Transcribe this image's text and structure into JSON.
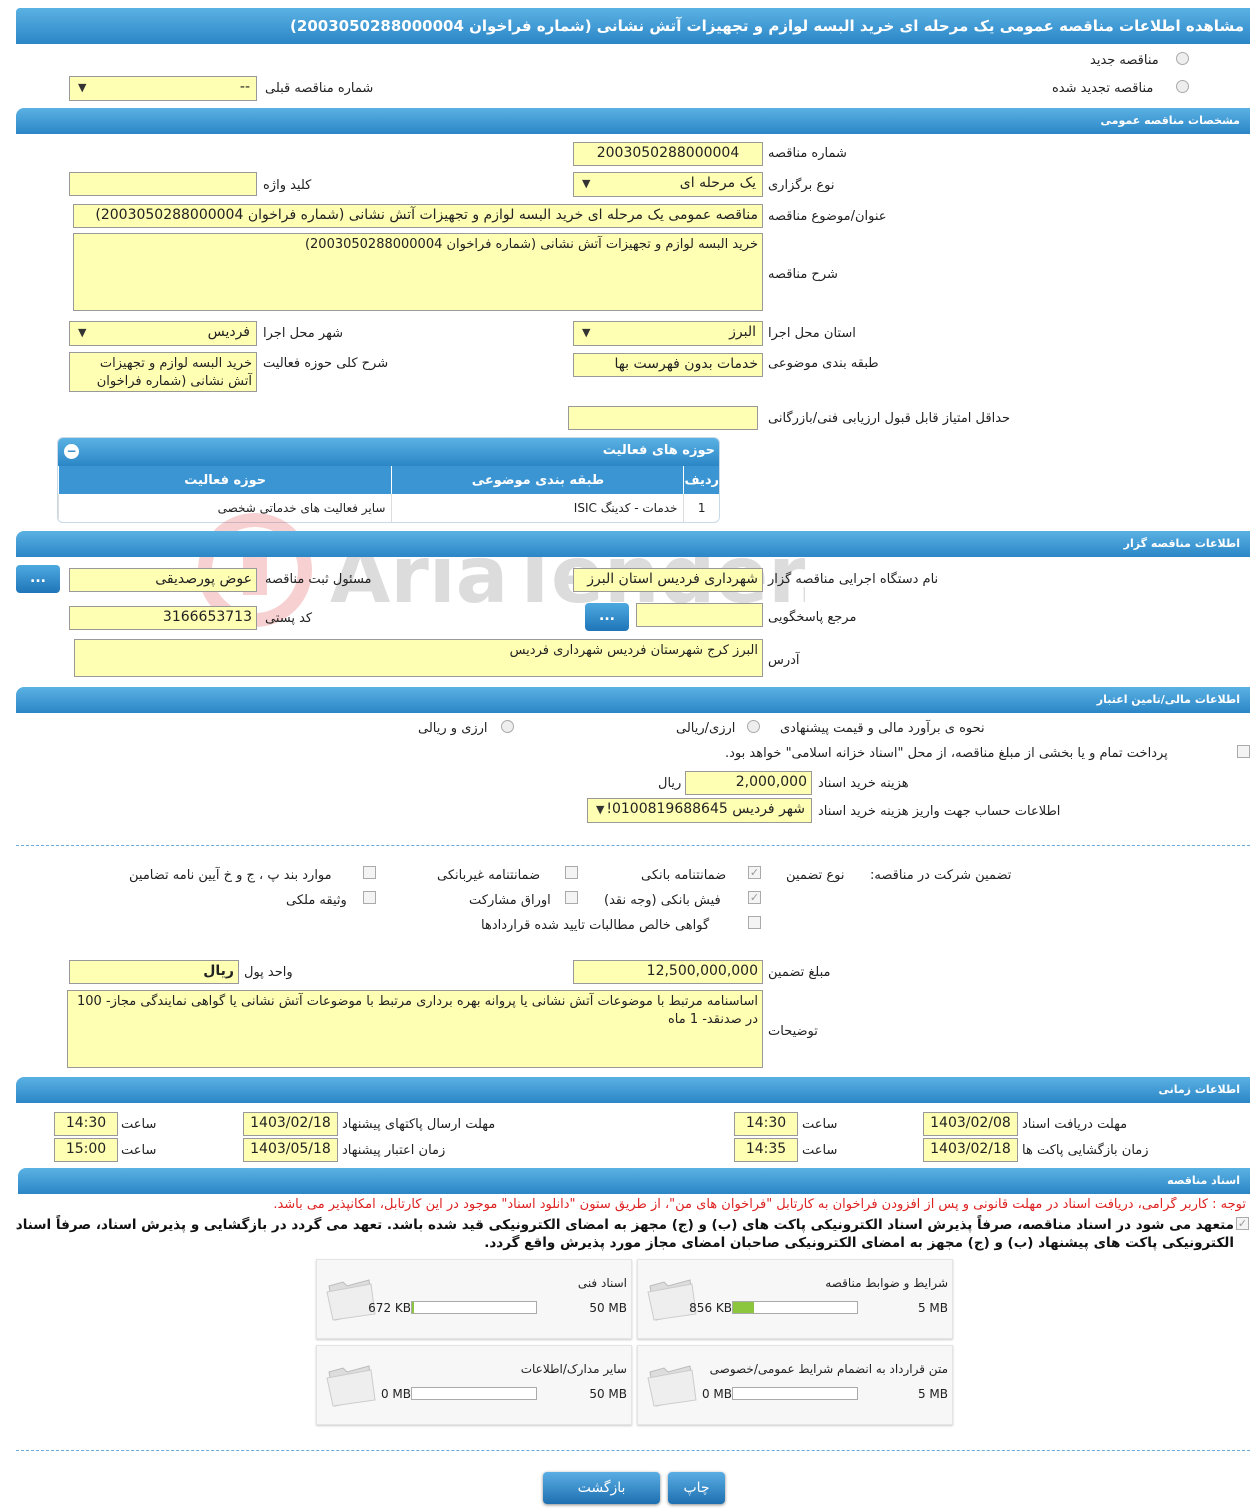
{
  "page": {
    "title": "مشاهده اطلاعات مناقصه عمومی یک مرحله ای خرید البسه لوازم و تجهیزات آتش نشانی (شماره فراخوان 2003050288000004)"
  },
  "top": {
    "new_tender": "مناقصه جدید",
    "renewed_tender": "مناقصه تجدید شده",
    "prev_number_label": "شماره مناقصه قبلی",
    "prev_number_value": "--"
  },
  "sections": {
    "general": "مشخصات مناقصه عمومی",
    "organizer": "اطلاعات مناقصه گزار",
    "financial": "اطلاعات مالی/تامین اعتبار",
    "timing": "اطلاعات زمانی",
    "documents": "اسناد مناقصه"
  },
  "general": {
    "number_label": "شماره مناقصه",
    "number": "2003050288000004",
    "type_label": "نوع برگزاری",
    "type": "یک مرحله ای",
    "keyword_label": "کلید واژه",
    "keyword": "",
    "subject_label": "عنوان/موضوع مناقصه",
    "subject": "مناقصه عمومی یک مرحله ای خرید البسه لوازم و تجهیزات آتش نشانی (شماره فراخوان 2003050288000004)",
    "desc_label": "شرح مناقصه",
    "desc": "خرید البسه لوازم و تجهیزات آتش نشانی (شماره فراخوان 2003050288000004)",
    "province_label": "استان محل اجرا",
    "province": "البرز",
    "city_label": "شهر محل اجرا",
    "city": "فردیس",
    "category_label": "طبقه بندی موضوعی",
    "category": "خدمات بدون فهرست بها",
    "activity_desc_label": "شرح کلی حوزه فعالیت",
    "activity_desc": "خرید البسه لوازم و تجهیزات آتش نشانی (شماره فراخوان",
    "min_score_label": "حداقل امتیاز قابل قبول ارزیابی فنی/بازرگانی",
    "min_score": ""
  },
  "activities": {
    "title": "حوزه های فعالیت",
    "headers": [
      "ردیف",
      "طبقه بندی موضوعی",
      "حوزه فعالیت"
    ],
    "rows": [
      [
        "1",
        "خدمات - کدینگ ISIC",
        "سایر فعالیت های خدماتی شخصی"
      ]
    ]
  },
  "organizer": {
    "org_label": "نام دستگاه اجرایی مناقصه گزار",
    "org": "شهرداری فردیس استان البرز",
    "officer_label": "مسئول ثبت مناقصه",
    "officer": "عوض پورصدیقی",
    "ref_label": "مرجع پاسخگویی",
    "ref": "",
    "postal_label": "کد پستی",
    "postal": "3166653713",
    "address_label": "آدرس",
    "address": "البرز کرج شهرستان فردیس شهرداری فردیس",
    "more": "..."
  },
  "financial": {
    "estimate_label": "نحوه ی برآورد مالی و قیمت پیشنهادی",
    "opt_rial": "ارزی/ریالی",
    "opt_fx": "ارزی و ریالی",
    "treasury_note": "پرداخت تمام و یا بخشی از مبلغ مناقصه، از محل \"اسناد خزانه اسلامی\" خواهد بود.",
    "doc_fee_label": "هزینه خرید اسناد",
    "doc_fee": "2,000,000",
    "currency": "ریال",
    "account_label": "اطلاعات حساب جهت واریز هزینه خرید اسناد",
    "account": "شهر فردیس 0100819688645!"
  },
  "guarantee": {
    "label": "تضمین شرکت در مناقصه:",
    "type_label": "نوع تضمین",
    "bank": "ضمانتنامه بانکی",
    "nonbank": "ضمانتنامه غیربانکی",
    "rules": "موارد بند پ ، ج و خ آیین نامه تضامین",
    "cash": "فیش بانکی (وجه نقد)",
    "bonds": "اوراق مشارکت",
    "property": "وثیقه ملکی",
    "receivables": "گواهی خالص مطالبات تایید شده قراردادها",
    "amount_label": "مبلغ تضمین",
    "amount": "12,500,000,000",
    "unit_label": "واحد پول",
    "unit": "ریال",
    "notes_label": "توضیحات",
    "notes": "اساسنامه مرتبط با موضوعات آتش نشانی یا پروانه بهره برداری مرتبط با موضوعات آتش نشانی یا گواهی نمایندگی مجاز- 100 در صدنقد- 1 ماه"
  },
  "timing": {
    "doc_deadline_label": "مهلت دریافت اسناد",
    "doc_deadline": "1403/02/08",
    "doc_time": "14:30",
    "submit_label": "مهلت ارسال پاکتهای پیشنهاد",
    "submit_date": "1403/02/18",
    "submit_time": "14:30",
    "open_label": "زمان بازگشایی پاکت ها",
    "open_date": "1403/02/18",
    "open_time": "14:35",
    "valid_label": "زمان اعتبار پیشنهاد",
    "valid_date": "1403/05/18",
    "valid_time": "15:00",
    "time_label": "ساعت"
  },
  "documents": {
    "note": "توجه : کاربر گرامی، دریافت اسناد در مهلت قانونی و پس از افزودن فراخوان به کارتابل \"فراخوان های من\"، از طریق ستون \"دانلود اسناد\" موجود در این کارتابل، امکانپذیر می باشد.",
    "commit": "متعهد می شود در اسناد مناقصه، صرفاً پذیرش اسناد الکترونیکی پاکت های (ب) و (ج) مجهز به امضای الکترونیکی قید شده باشد. تعهد می گردد در بازگشایی و پذیرش اسناد، صرفاً اسناد الکترونیکی پاکت های پیشنهاد (ب) و (ج) مجهز به امضای الکترونیکی صاحبان امضای مجاز مورد پذیرش واقع گردد.",
    "items": [
      {
        "title": "شرایط و ضوابط مناقصه",
        "size": "856 KB",
        "max": "5 MB",
        "fill": 0.17
      },
      {
        "title": "اسناد فنی",
        "size": "672 KB",
        "max": "50 MB",
        "fill": 0.013
      },
      {
        "title": "متن قرارداد به انضمام شرایط عمومی/خصوصی",
        "size": "0 MB",
        "max": "5 MB",
        "fill": 0
      },
      {
        "title": "سایر مدارک/اطلاعات",
        "size": "0 MB",
        "max": "50 MB",
        "fill": 0
      }
    ]
  },
  "buttons": {
    "print": "چاپ",
    "back": "بازگشت"
  },
  "watermark": "AriaTender.neT"
}
